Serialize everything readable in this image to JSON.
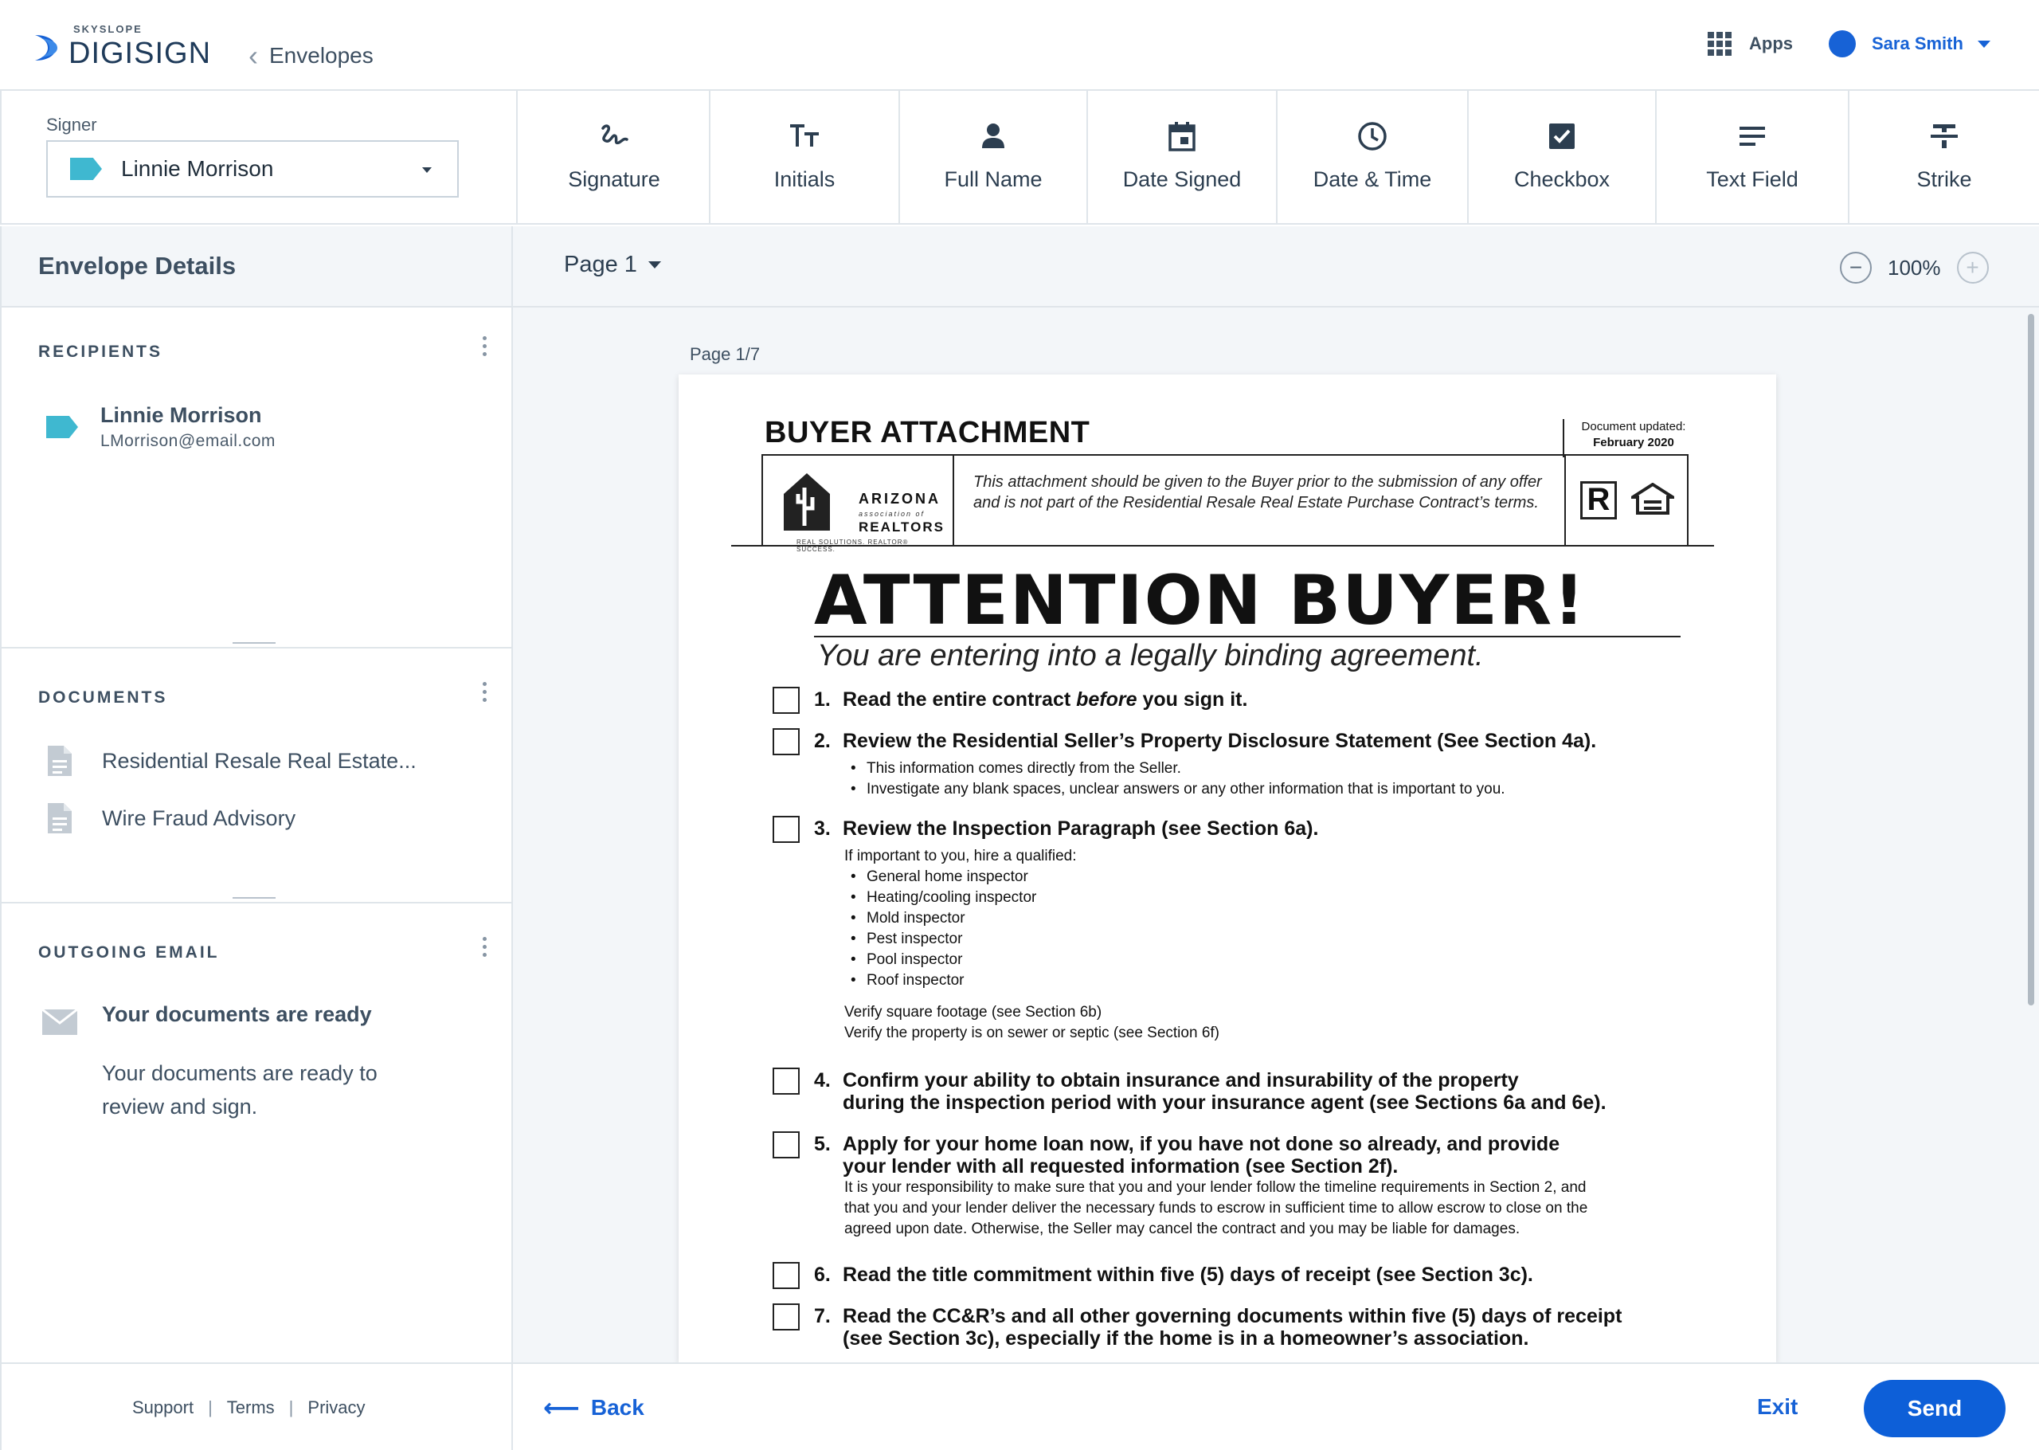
{
  "header": {
    "logo_small": "SKYSLOPE",
    "logo_big": "DIGISIGN",
    "back_label": "Envelopes",
    "apps_label": "Apps",
    "user_name": "Sara Smith"
  },
  "signer": {
    "label": "Signer",
    "selected": "Linnie Morrison"
  },
  "tools": [
    {
      "label": "Signature",
      "icon": "signature-icon"
    },
    {
      "label": "Initials",
      "icon": "initials-icon"
    },
    {
      "label": "Full Name",
      "icon": "person-icon"
    },
    {
      "label": "Date Signed",
      "icon": "calendar-icon"
    },
    {
      "label": "Date & Time",
      "icon": "clock-icon"
    },
    {
      "label": "Checkbox",
      "icon": "checkbox-icon"
    },
    {
      "label": "Text Field",
      "icon": "text-lines-icon"
    },
    {
      "label": "Strike",
      "icon": "strikethrough-icon"
    }
  ],
  "sidebar": {
    "title": "Envelope Details",
    "recipients_title": "RECIPIENTS",
    "recipient": {
      "name": "Linnie Morrison",
      "email": "LMorrison@email.com"
    },
    "documents_title": "DOCUMENTS",
    "documents": [
      "Residential Resale Real Estate...",
      "Wire Fraud Advisory"
    ],
    "outgoing_title": "OUTGOING EMAIL",
    "email_subject": "Your documents are ready",
    "email_body": "Your documents are ready to review and sign."
  },
  "viewer": {
    "page_select": "Page 1",
    "zoom": "100%",
    "page_label": "Page 1/7"
  },
  "document": {
    "title": "BUYER ATTACHMENT",
    "updated_label": "Document updated:",
    "updated_date": "February 2020",
    "logo_arizona": "ARIZONA",
    "logo_assoc": "association of",
    "logo_realtors": "REALTORS",
    "logo_tagline": "REAL SOLUTIONS. REALTOR® SUCCESS.",
    "notice": "This attachment should be given to the Buyer prior to the submission of any offer and is not part of the Residential Resale Real Estate Purchase Contract’s terms.",
    "headline": "ATTENTION BUYER!",
    "subheadline": "You are entering into a legally binding agreement.",
    "items": [
      {
        "num": "1.",
        "pre": "Read the entire contract ",
        "em": "before",
        "post": " you sign it."
      },
      {
        "num": "2.",
        "text": "Review the Residential Seller’s Property Disclosure Statement (See Section 4a)."
      },
      {
        "num": "3.",
        "text": "Review the Inspection Paragraph (see Section 6a)."
      },
      {
        "num": "4.",
        "line1": "Confirm your ability to obtain insurance and insurability of the property",
        "line2": "during the inspection period with your insurance agent (see Sections 6a and 6e)."
      },
      {
        "num": "5.",
        "line1": "Apply for your home loan now, if you have not done so already, and provide",
        "line2": "your lender with all requested information (see Section 2f)."
      },
      {
        "num": "6.",
        "text": "Read the title commitment within five (5) days of receipt (see Section 3c)."
      },
      {
        "num": "7.",
        "line1": "Read the CC&R’s and all other governing documents within five (5) days of receipt",
        "line2": "(see Section 3c), especially if the home is in a homeowner’s association."
      }
    ],
    "item2_bullets": [
      "This information comes directly from the Seller.",
      "Investigate any blank spaces, unclear answers or any other information that is important to you."
    ],
    "item3_intro": "If important to you, hire a qualified:",
    "item3_bullets": [
      "General home inspector",
      "Heating/cooling inspector",
      "Mold inspector",
      "Pest inspector",
      "Pool inspector",
      "Roof inspector"
    ],
    "item3_verify1": "Verify square footage (see Section 6b)",
    "item3_verify2": "Verify the property is on sewer or septic (see Section 6f)",
    "item5_body1": "It is your responsibility to make sure that you and your lender follow the timeline requirements in Section 2, and",
    "item5_body2": "that you and your lender deliver the necessary funds to escrow in sufficient time to allow escrow to close on the",
    "item5_body3": "agreed upon date. Otherwise, the Seller may cancel the contract and you may be liable for damages."
  },
  "footer": {
    "support": "Support",
    "terms": "Terms",
    "privacy": "Privacy",
    "separator": "|",
    "back": "Back",
    "exit": "Exit",
    "send": "Send"
  },
  "colors": {
    "accent": "#1762d6",
    "tag": "#3fb8d0",
    "send_button": "#0d5fd8"
  }
}
